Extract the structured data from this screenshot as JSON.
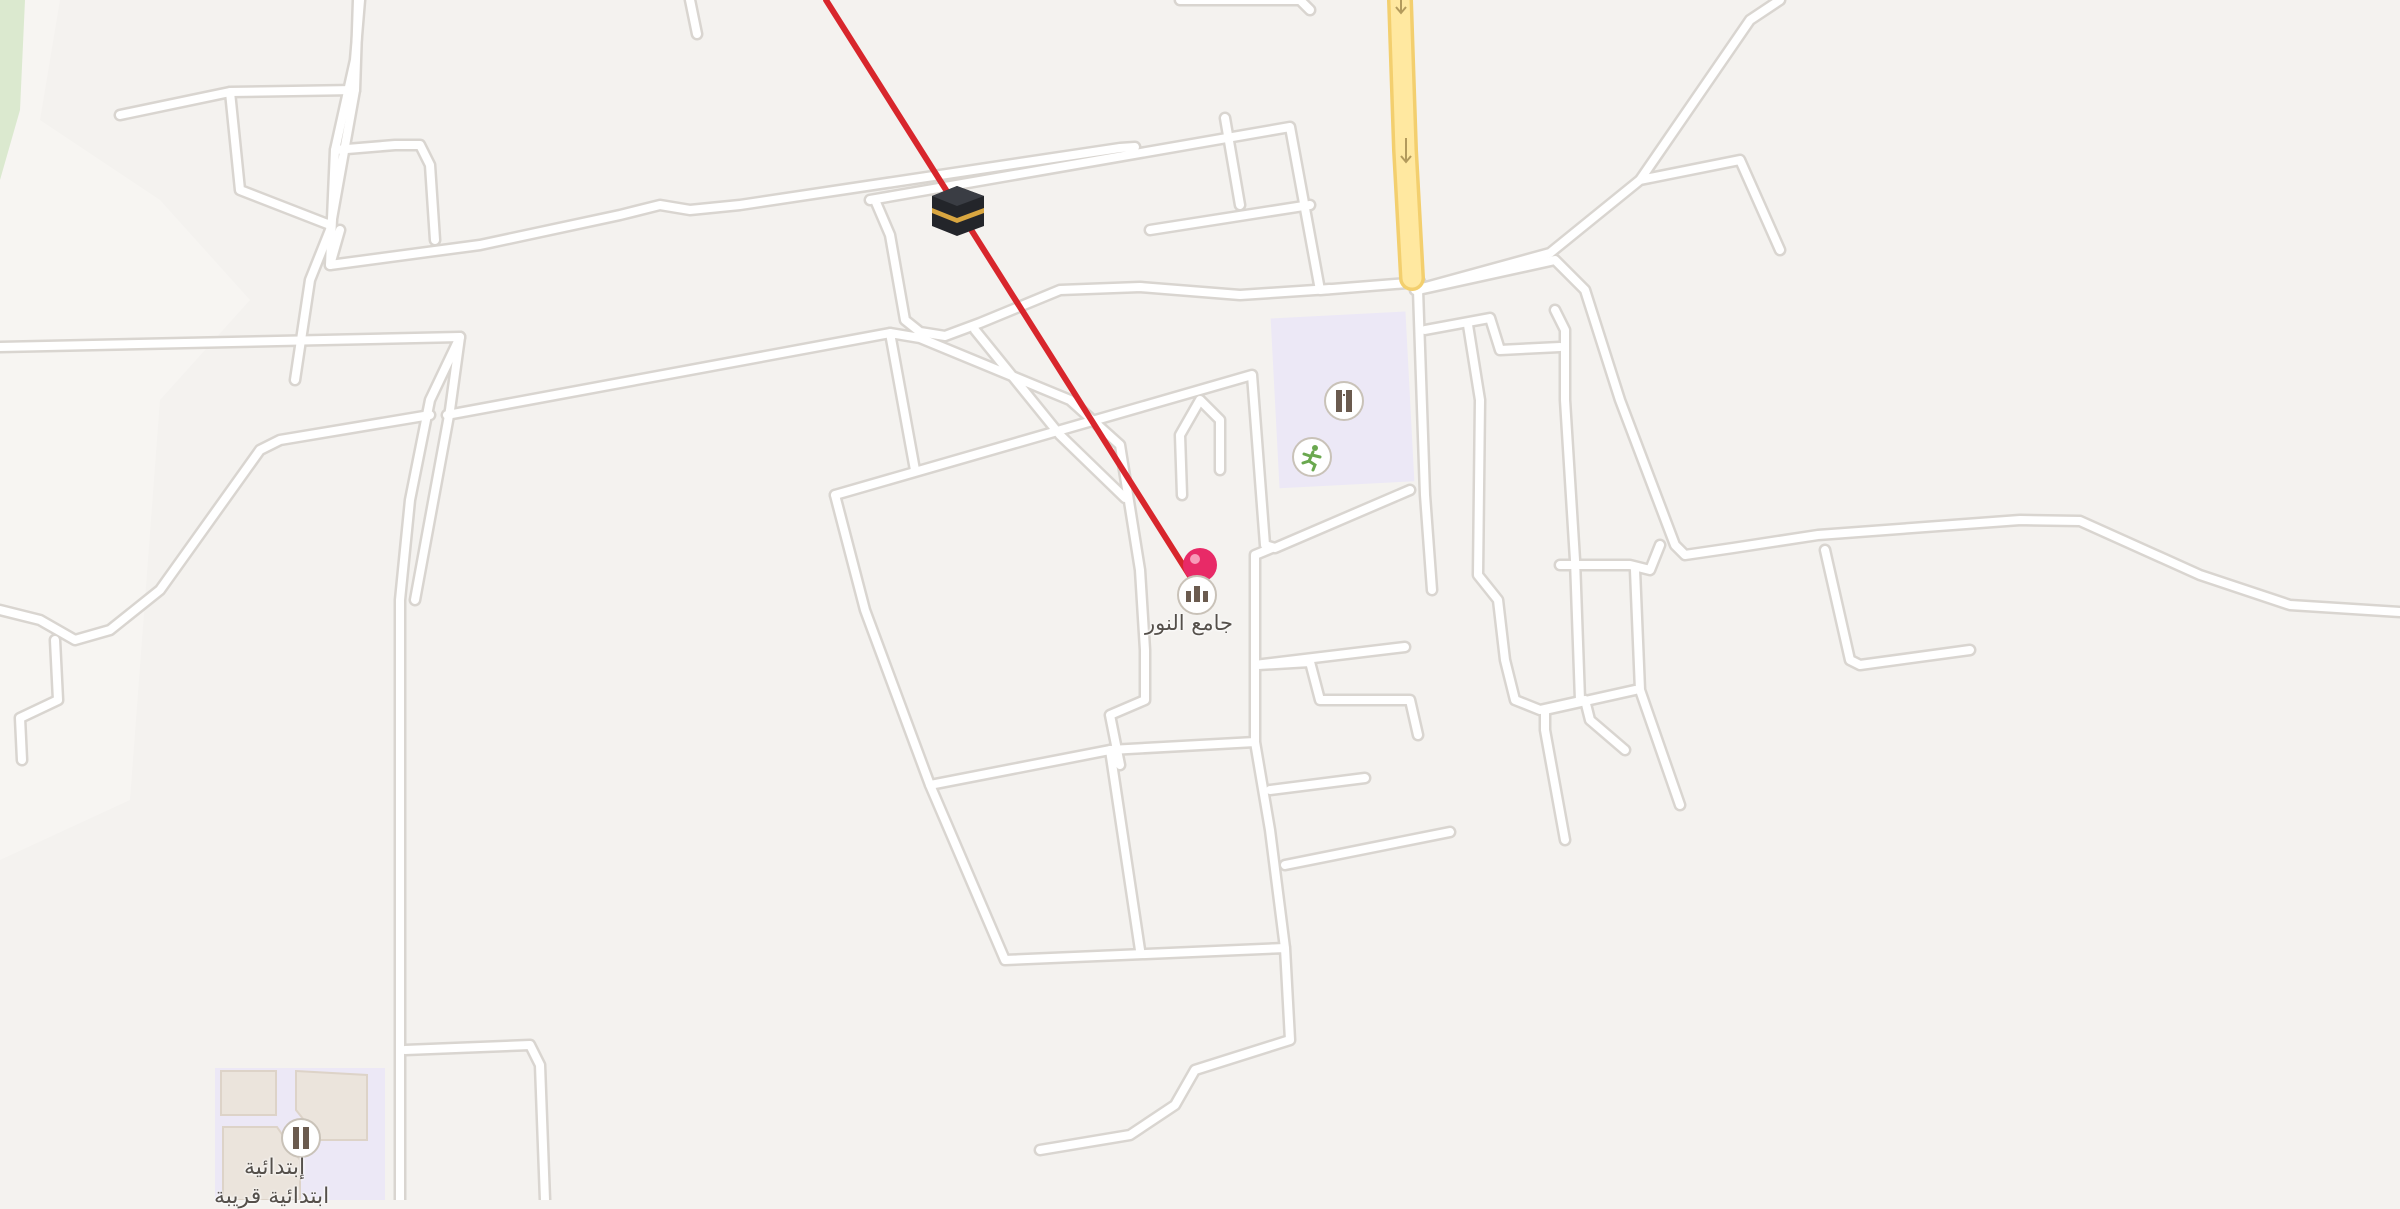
{
  "map": {
    "places": [
      {
        "name": "جامع النور",
        "type": "mosque"
      },
      {
        "name": "إبتدائية",
        "type": "school"
      }
    ],
    "school_label_second_line": "ابتدائية قريبة",
    "icons": [
      "kaaba-icon",
      "mosque-icon",
      "school-icon",
      "sports-icon",
      "pin-icon",
      "oneway-arrow-icon"
    ],
    "colors": {
      "background": "#f4f2ef",
      "road": "#ffffff",
      "road_casing": "#d9d5d0",
      "major_road": "#ffe8a0",
      "major_road_casing": "#f3cf6e",
      "qibla_line": "#d8262c",
      "pin": "#e82a67",
      "school_area": "#ece8f6",
      "park": "#dbe9cf"
    }
  }
}
